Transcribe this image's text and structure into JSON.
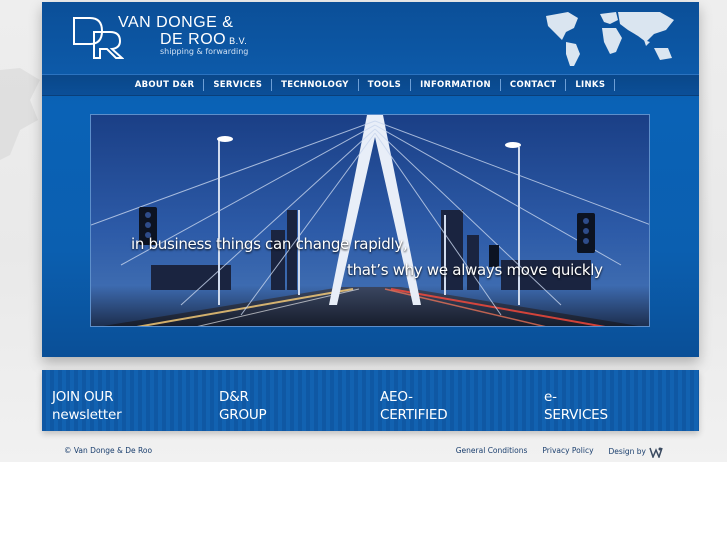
{
  "logo": {
    "line1": "VAN DONGE &",
    "line2": "DE ROO",
    "suffix": "B.V.",
    "tagline": "shipping & forwarding",
    "monogram": "D&R"
  },
  "nav": {
    "items": [
      {
        "label": "ABOUT D&R"
      },
      {
        "label": "SERVICES"
      },
      {
        "label": "TECHNOLOGY"
      },
      {
        "label": "TOOLS"
      },
      {
        "label": "INFORMATION"
      },
      {
        "label": "CONTACT"
      },
      {
        "label": "LINKS"
      }
    ]
  },
  "hero": {
    "line1": "in business things can change rapidly,",
    "line2": "that’s why we always move quickly"
  },
  "promos": [
    {
      "line1": "JOIN OUR",
      "line2": "newsletter"
    },
    {
      "line1": "D&R",
      "line2": "GROUP"
    },
    {
      "line1": "AEO-",
      "line2": "CERTIFIED"
    },
    {
      "line1": "e-",
      "line2": "SERVICES"
    }
  ],
  "footer": {
    "copyright": "© Van Donge & De Roo",
    "general_conditions": "General Conditions",
    "privacy_policy": "Privacy Policy",
    "design_by": "Design by"
  },
  "colors": {
    "brand_blue": "#0b5fb0",
    "nav_blue": "#0b4f98",
    "footer_text": "#1b3f6e"
  },
  "icons": {
    "world_map": "world-map-icon",
    "designer_logo": "designer-logo-icon"
  }
}
